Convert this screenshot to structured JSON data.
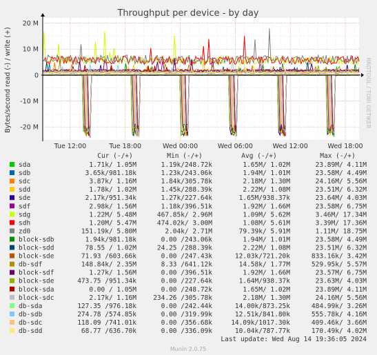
{
  "chart_data": {
    "type": "line",
    "title": "Throughput per device - by day",
    "ylabel": "Bytes/second read (-) / write (+)",
    "ylim": [
      -25000000,
      22000000
    ],
    "yticks": [
      {
        "v": 20000000,
        "label": "20 M"
      },
      {
        "v": 10000000,
        "label": "10 M"
      },
      {
        "v": 0,
        "label": "0"
      },
      {
        "v": -10000000,
        "label": "-10 M"
      },
      {
        "v": -20000000,
        "label": "-20 M"
      }
    ],
    "xlim": [
      "2024-08-13 09:00",
      "2024-08-14 19:30"
    ],
    "xticks": [
      {
        "t": "2024-08-13 12:00",
        "label": "Tue 12:00"
      },
      {
        "t": "2024-08-13 18:00",
        "label": "Tue 18:00"
      },
      {
        "t": "2024-08-14 00:00",
        "label": "Wed 00:00"
      },
      {
        "t": "2024-08-14 06:00",
        "label": "Wed 06:00"
      },
      {
        "t": "2024-08-14 12:00",
        "label": "Wed 12:00"
      },
      {
        "t": "2024-08-14 18:00",
        "label": "Wed 18:00"
      }
    ],
    "grid": true,
    "watermark": "RRDTOOL / TOBI OETIKER",
    "columns": [
      "Cur (-/+)",
      "Min (-/+)",
      "Avg (-/+)",
      "Max (-/+)"
    ],
    "series": [
      {
        "name": "sda",
        "color": "#00cc00",
        "cur": "1.71k/ 1.05M",
        "min": "1.19k/248.72k",
        "avg": "1.65M/ 1.02M",
        "max": "23.89M/ 4.11M"
      },
      {
        "name": "sdb",
        "color": "#0066b3",
        "cur": "3.65k/981.18k",
        "min": "1.23k/243.06k",
        "avg": "1.94M/ 1.01M",
        "max": "23.58M/ 4.49M"
      },
      {
        "name": "sdc",
        "color": "#ff8000",
        "cur": "3.87k/ 1.16M",
        "min": "1.84k/305.78k",
        "avg": "2.18M/ 1.30M",
        "max": "24.16M/ 5.56M"
      },
      {
        "name": "sdd",
        "color": "#ffcc00",
        "cur": "1.78k/ 1.02M",
        "min": "1.45k/288.39k",
        "avg": "2.22M/ 1.08M",
        "max": "23.51M/ 6.32M"
      },
      {
        "name": "sde",
        "color": "#330099",
        "cur": "2.17k/951.34k",
        "min": "1.27k/227.64k",
        "avg": "1.65M/938.37k",
        "max": "23.64M/ 4.03M"
      },
      {
        "name": "sdf",
        "color": "#990099",
        "cur": "2.98k/ 1.56M",
        "min": "1.18k/396.51k",
        "avg": "1.92M/ 1.66M",
        "max": "23.58M/ 6.75M"
      },
      {
        "name": "sdg",
        "color": "#ccff00",
        "cur": "1.22M/ 5.48M",
        "min": "467.85k/ 2.96M",
        "avg": "1.09M/ 5.62M",
        "max": "3.46M/ 17.34M"
      },
      {
        "name": "sdh",
        "color": "#ff0000",
        "cur": "1.20M/ 5.47M",
        "min": "474.02k/ 3.00M",
        "avg": "1.08M/ 5.61M",
        "max": "3.39M/ 17.36M"
      },
      {
        "name": "zd0",
        "color": "#808080",
        "cur": "151.19k/ 5.80M",
        "min": "2.04k/ 2.71M",
        "avg": "79.39k/ 5.91M",
        "max": "1.11M/ 18.75M"
      },
      {
        "name": "block-sdb",
        "color": "#008f00",
        "cur": "1.94k/981.18k",
        "min": "0.00 /243.06k",
        "avg": "1.94M/ 1.01M",
        "max": "23.58M/ 4.49M"
      },
      {
        "name": "block-sdd",
        "color": "#00487d",
        "cur": "78.55 / 1.02M",
        "min": "24.25 /288.39k",
        "avg": "2.22M/ 1.08M",
        "max": "23.51M/ 6.32M"
      },
      {
        "name": "block-sde",
        "color": "#b35a00",
        "cur": "71.93 /603.66k",
        "min": "0.00 /247.43k",
        "avg": "12.03k/721.20k",
        "max": "833.16k/ 3.42M"
      },
      {
        "name": "db-sdf",
        "color": "#b38f00",
        "cur": "148.84k/ 2.35M",
        "min": "8.33 /641.12k",
        "avg": "14.58k/ 1.77M",
        "max": "529.95k/ 5.57M"
      },
      {
        "name": "block-sdf",
        "color": "#6b006b",
        "cur": "1.27k/ 1.56M",
        "min": "0.00 /396.51k",
        "avg": "1.92M/ 1.66M",
        "max": "23.57M/ 6.75M"
      },
      {
        "name": "block-sde",
        "color": "#8fb300",
        "cur": "473.75 /951.34k",
        "min": "0.00 /227.64k",
        "avg": "1.64M/938.37k",
        "max": "23.63M/ 4.03M"
      },
      {
        "name": "block-sda",
        "color": "#b30000",
        "cur": "0.00 / 1.05M",
        "min": "0.00 /248.72k",
        "avg": "1.65M/ 1.02M",
        "max": "23.89M/ 4.11M"
      },
      {
        "name": "block-sdc",
        "color": "#bebebe",
        "cur": "2.17k/ 1.16M",
        "min": "234.26 /305.78k",
        "avg": "2.18M/ 1.30M",
        "max": "24.16M/ 5.56M"
      },
      {
        "name": "db-sda",
        "color": "#80ff80",
        "cur": "127.35 /976.18k",
        "min": "0.00 /242.44k",
        "avg": "14.00k/873.25k",
        "max": "484.99k/ 3.26M"
      },
      {
        "name": "db-sdb",
        "color": "#80c9ff",
        "cur": "274.78 /574.85k",
        "min": "0.00 /319.99k",
        "avg": "12.51k/841.80k",
        "max": "555.78k/ 4.16M"
      },
      {
        "name": "db-sdc",
        "color": "#ffc080",
        "cur": "118.09 /741.01k",
        "min": "0.00 /356.68k",
        "avg": "14.09k/1017.30k",
        "max": "409.46k/ 3.66M"
      },
      {
        "name": "db-sdd",
        "color": "#ffe680",
        "cur": "68.77 /636.70k",
        "min": "0.00 /336.09k",
        "avg": "10.04k/787.77k",
        "max": "170.49k/ 4.02M"
      }
    ],
    "last_update": "Last update: Wed Aug 14 19:36:05 2024",
    "footer": "Munin 2.0.75"
  }
}
